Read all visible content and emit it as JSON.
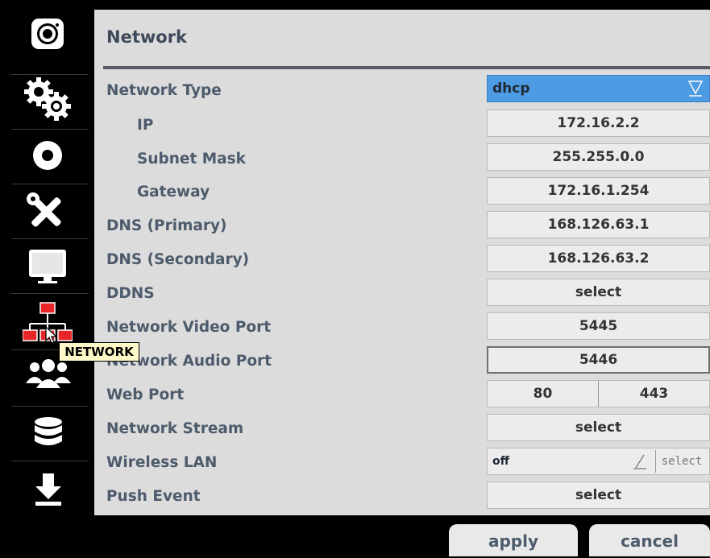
{
  "tooltip": "NETWORK",
  "sidebar": {
    "items": [
      {
        "icon": "camera-icon"
      },
      {
        "icon": "gears-icon"
      },
      {
        "icon": "record-icon"
      },
      {
        "icon": "tools-icon"
      },
      {
        "icon": "monitor-icon"
      },
      {
        "icon": "network-icon",
        "active": true
      },
      {
        "icon": "users-icon"
      },
      {
        "icon": "database-icon"
      },
      {
        "icon": "download-icon"
      }
    ]
  },
  "panel": {
    "title": "Network",
    "rows": [
      {
        "label": "Network Type",
        "value": "dhcp"
      },
      {
        "label": "IP",
        "value": "172.16.2.2"
      },
      {
        "label": "Subnet Mask",
        "value": "255.255.0.0"
      },
      {
        "label": "Gateway",
        "value": "172.16.1.254"
      },
      {
        "label": "DNS (Primary)",
        "value": "168.126.63.1"
      },
      {
        "label": "DNS (Secondary)",
        "value": "168.126.63.2"
      },
      {
        "label": "DDNS",
        "value": "select"
      },
      {
        "label": "Network Video Port",
        "value": "5445"
      },
      {
        "label": "Network Audio Port",
        "value": "5446"
      },
      {
        "label": "Web Port",
        "value_http": "80",
        "value_https": "443"
      },
      {
        "label": "Network Stream",
        "value": "select"
      },
      {
        "label": "Wireless LAN",
        "value": "off",
        "button": "select"
      },
      {
        "label": "Push Event",
        "value": "select"
      }
    ]
  },
  "buttons": {
    "apply": "apply",
    "cancel": "cancel"
  },
  "colors": {
    "highlight": "#4d9be3",
    "panel": "#dcdcdc",
    "label": "#4d5b6c"
  }
}
